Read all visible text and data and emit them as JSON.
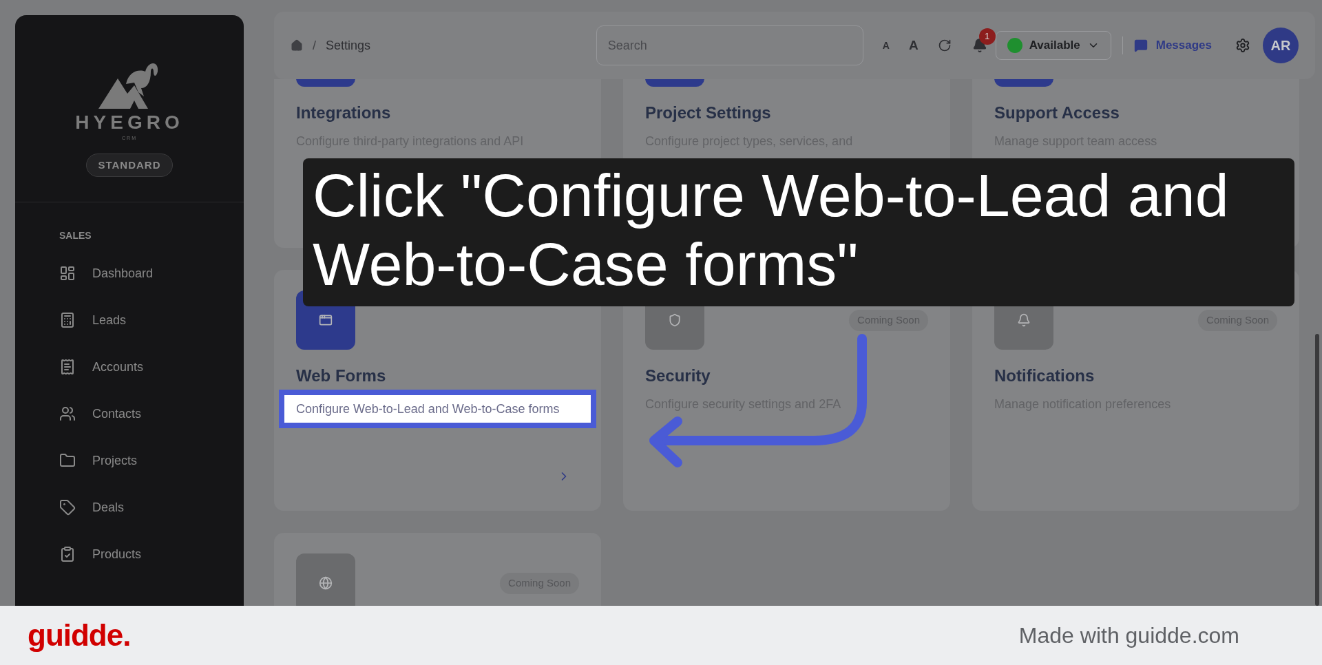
{
  "sidebar": {
    "brand": "HYEGRO",
    "brand_sub": "CRM",
    "plan": "STANDARD",
    "section": "SALES",
    "items": [
      {
        "label": "Dashboard"
      },
      {
        "label": "Leads"
      },
      {
        "label": "Accounts"
      },
      {
        "label": "Contacts"
      },
      {
        "label": "Projects"
      },
      {
        "label": "Deals"
      },
      {
        "label": "Products"
      }
    ]
  },
  "breadcrumb": {
    "separator": "/",
    "current": "Settings"
  },
  "header": {
    "search": {
      "placeholder": "Search"
    },
    "font_small": "A",
    "font_large": "A",
    "notifications": {
      "count": "1"
    },
    "status": {
      "label": "Available",
      "color": "#1f8f2f"
    },
    "messages": "Messages",
    "avatar": "AR"
  },
  "cards": [
    {
      "title": "Integrations",
      "description": "Configure third-party integrations and API",
      "enabled": true,
      "highlighted": false,
      "chevron": false
    },
    {
      "title": "Project Settings",
      "description": "Configure project types, services, and",
      "enabled": true,
      "highlighted": false,
      "chevron": false
    },
    {
      "title": "Support Access",
      "description": "Manage support team access",
      "enabled": true,
      "highlighted": false,
      "chevron": false
    },
    {
      "title": "Web Forms",
      "description": "Configure Web-to-Lead and Web-to-Case forms",
      "enabled": true,
      "highlighted": true,
      "chevron": true
    },
    {
      "title": "Security",
      "description": "Configure security settings and 2FA",
      "enabled": false,
      "badge": "Coming Soon",
      "highlighted": false,
      "chevron": false
    },
    {
      "title": "Notifications",
      "description": "Manage notification preferences",
      "enabled": false,
      "badge": "Coming Soon",
      "highlighted": false,
      "chevron": false
    },
    {
      "enabled": false,
      "badge": "Coming Soon",
      "highlighted": false,
      "chevron": false
    }
  ],
  "caption": {
    "text": "Click \"Configure Web-to-Lead and Web-to-Case forms\""
  },
  "footer": {
    "brand": "guidde.",
    "credit": "Made with guidde.com"
  }
}
